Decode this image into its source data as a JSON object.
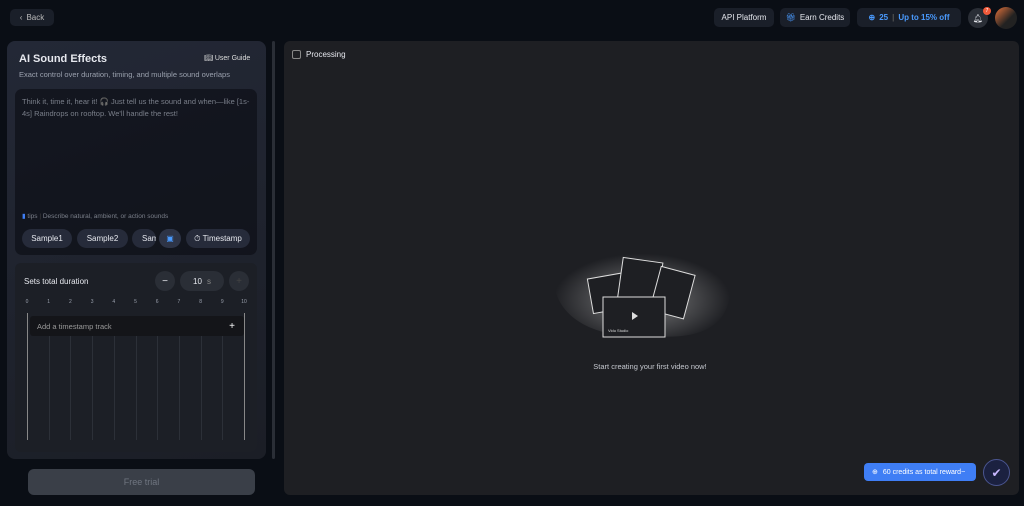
{
  "header": {
    "back": "Back",
    "api_platform": "API Platform",
    "earn_credits": "Earn Credits",
    "credits": "25",
    "discount": "Up to  15% off",
    "notifications": "7"
  },
  "panel": {
    "title": "AI Sound Effects",
    "user_guide": "User Guide",
    "subtitle": "Exact control over duration, timing, and multiple sound overlaps",
    "prompt_placeholder": "Think it, time it, hear it! 🎧 Just tell us the sound and when—like [1s-4s] Raindrops on rooftop. We'll handle the rest!",
    "tips_label": "tips",
    "tips_text": "Describe natural, ambient, or action sounds",
    "samples": [
      "Sample1",
      "Sample2",
      "Sam"
    ],
    "timestamp": "Timestamp",
    "duration_label": "Sets total duration",
    "duration_value": "10",
    "duration_unit": "s",
    "ticks": [
      "0",
      "1",
      "2",
      "3",
      "4",
      "5",
      "6",
      "7",
      "8",
      "9",
      "10"
    ],
    "add_track": "Add a timestamp track",
    "free_trial": "Free trial"
  },
  "main": {
    "processing": "Processing",
    "empty_text": "Start creating your first video now!",
    "illustration_text": "Vidu Studio"
  },
  "reward": {
    "text": "60 credits as total reward~"
  },
  "colors": {
    "accent": "#3f7ef5",
    "badge": "#f25a3a"
  }
}
